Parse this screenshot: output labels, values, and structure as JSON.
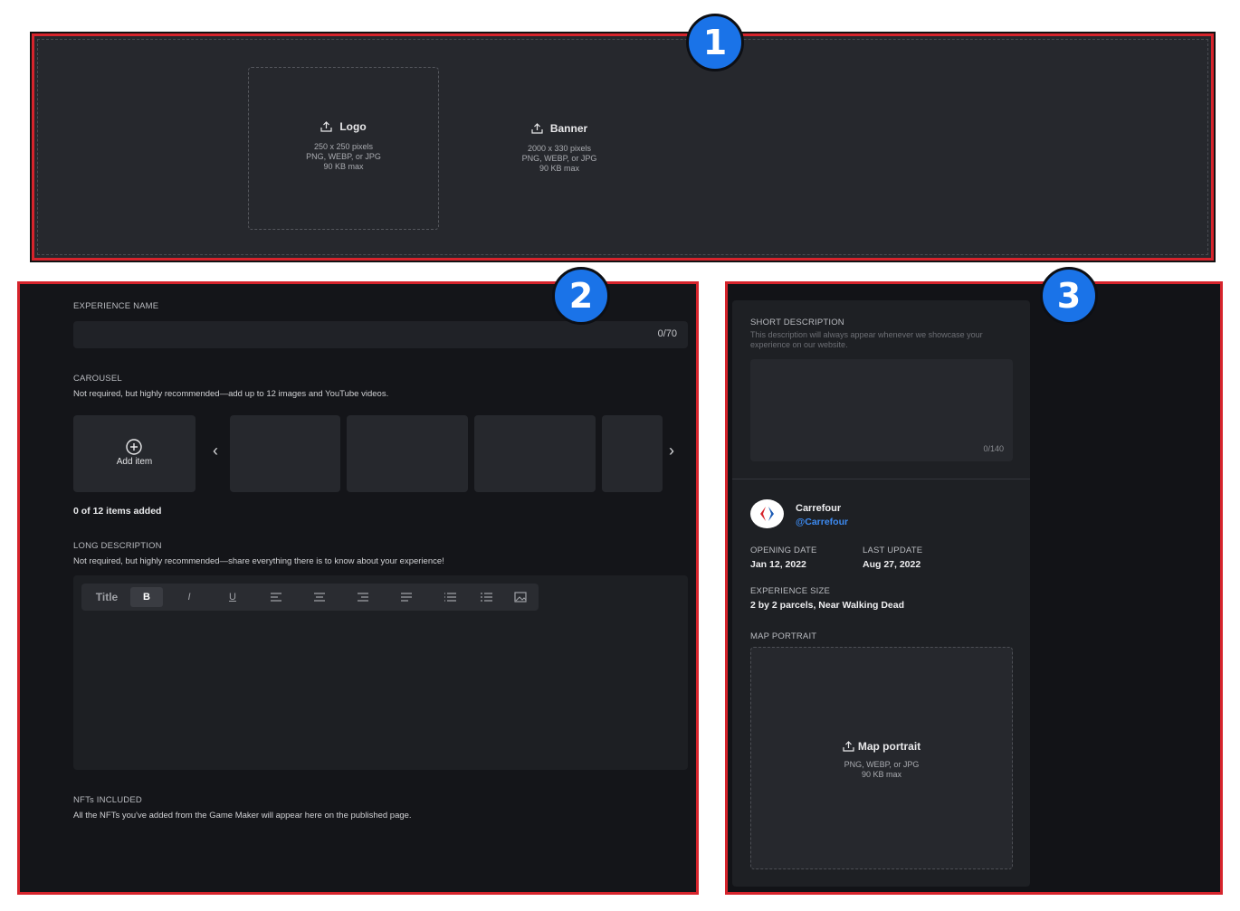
{
  "badges": [
    "1",
    "2",
    "3"
  ],
  "uploads": {
    "logo": {
      "title": "Logo",
      "size": "250 x 250 pixels",
      "formats": "PNG, WEBP, or JPG",
      "max": "90 KB max"
    },
    "banner": {
      "title": "Banner",
      "size": "2000 x 330 pixels",
      "formats": "PNG, WEBP, or JPG",
      "max": "90 KB max"
    }
  },
  "experience_name": {
    "label": "EXPERIENCE NAME",
    "counter": "0/70"
  },
  "carousel": {
    "label": "CAROUSEL",
    "help": "Not required, but highly recommended—add up to 12 images and YouTube videos.",
    "add_item": "Add item",
    "count": "0 of 12 items added"
  },
  "long_description": {
    "label": "LONG DESCRIPTION",
    "help": "Not required, but highly recommended—share everything there is to know about your experience!",
    "toolbar": {
      "title": "Title",
      "bold": "B",
      "italic": "I",
      "underline": "U"
    }
  },
  "nfts": {
    "label": "NFTs INCLUDED",
    "help": "All the NFTs you've added from the Game Maker will appear here on the published page."
  },
  "short_description": {
    "label": "SHORT DESCRIPTION",
    "help": "This description will always appear whenever we showcase your experience on our website.",
    "counter": "0/140"
  },
  "brand": {
    "name": "Carrefour",
    "handle": "@Carrefour"
  },
  "dates": {
    "opening_label": "OPENING DATE",
    "opening_value": "Jan 12, 2022",
    "update_label": "LAST UPDATE",
    "update_value": "Aug 27, 2022"
  },
  "experience_size": {
    "label": "EXPERIENCE SIZE",
    "value": "2 by 2 parcels, Near Walking Dead"
  },
  "map_portrait": {
    "label": "MAP PORTRAIT",
    "title": "Map portrait",
    "formats": "PNG, WEBP, or JPG",
    "max": "90 KB max"
  },
  "colors": {
    "highlight": "#d6242c",
    "badge": "#1a73e8",
    "link": "#3d8bf2"
  }
}
